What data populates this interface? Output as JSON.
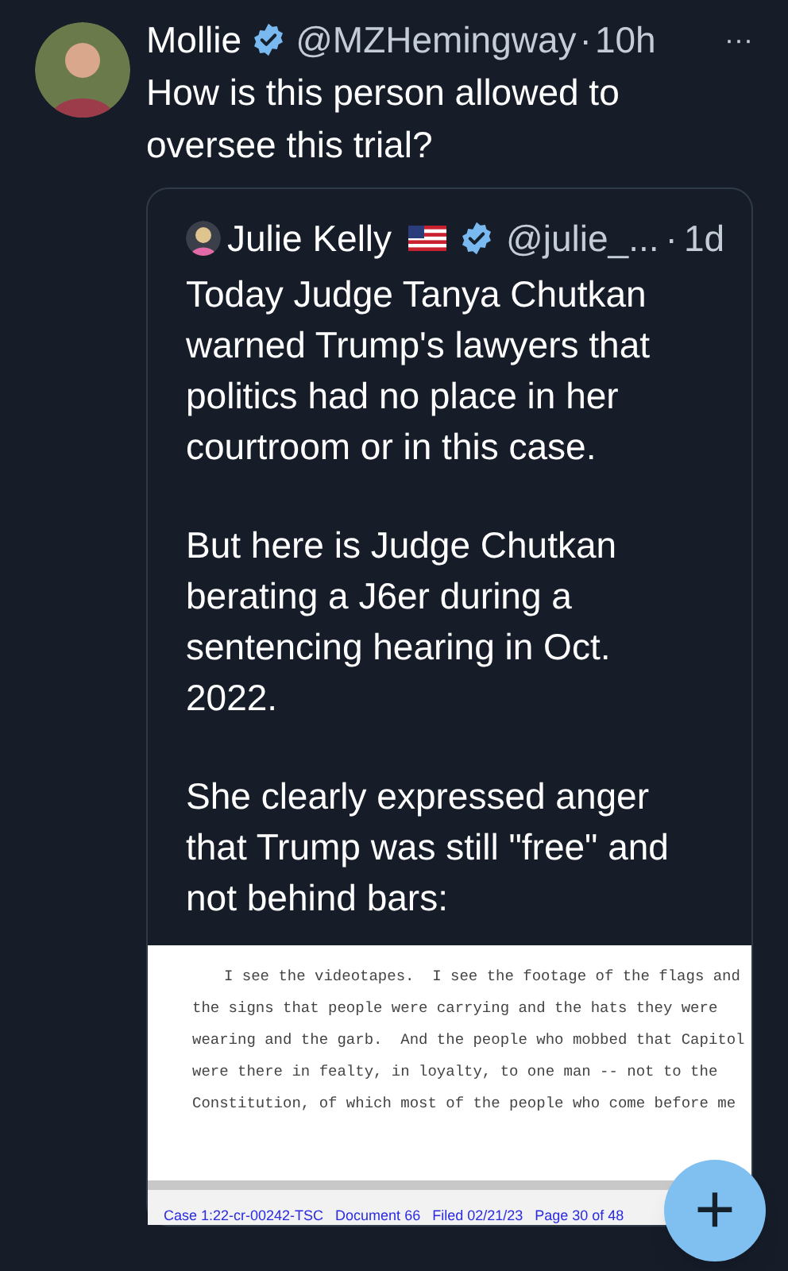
{
  "tweet": {
    "author": "Mollie",
    "handle": "@MZHemingway",
    "separator": "·",
    "time": "10h",
    "more": "···",
    "text": "How is this person allowed to oversee this trial?",
    "quote": {
      "author": "Julie Kelly",
      "handle": "@julie_...",
      "separator": "·",
      "time": "1d",
      "paragraphs": [
        "Today Judge Tanya Chutkan warned Trump's lawyers that politics had no place in her courtroom or in this case.",
        "But here is Judge Chutkan berating a J6er during a sentencing hearing in Oct. 2022.",
        "She clearly expressed anger that Trump was still \"free\" and not behind bars:"
      ],
      "document": {
        "lines": [
          "I see the videotapes.  I see the footage of the flags and",
          "the signs that people were carrying and the hats they were",
          "wearing and the garb.  And the people who mobbed that Capitol",
          "were there in fealty, in loyalty, to one man -- not to the",
          "Constitution, of which most of the people who come before me"
        ],
        "footer": "Case 1:22-cr-00242-TSC   Document 66   Filed 02/21/23   Page 30 of 48"
      }
    }
  },
  "compose_button": {
    "label": "+"
  }
}
